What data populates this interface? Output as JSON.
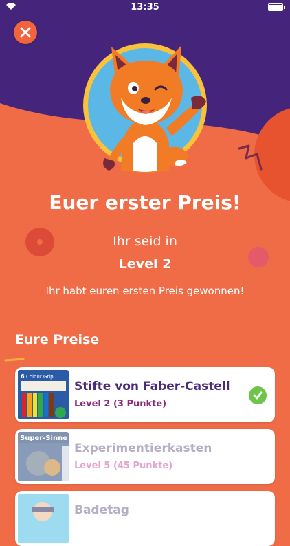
{
  "status_bar": {
    "time": "13:35"
  },
  "header": {
    "close_icon": "close-icon",
    "mascot": "fox-mascot"
  },
  "title": "Euer erster Preis!",
  "level_intro": "Ihr seid in",
  "level": "Level 2",
  "message": "Ihr habt euren ersten Preis gewonnen!",
  "prizes_section": {
    "title": "Eure Preise",
    "items": [
      {
        "name": "Stifte von Faber-Castell",
        "level": "Level 2 (3 Punkte)",
        "unlocked": true,
        "thumb_text": "Colour Grip"
      },
      {
        "name": "Experimentierkasten",
        "level": "Level 5 (45 Punkte)",
        "unlocked": false,
        "thumb_text": "Super-Sinne"
      },
      {
        "name": "Badetag",
        "level": "",
        "unlocked": false,
        "thumb_text": ""
      }
    ]
  },
  "colors": {
    "background": "#f06c47",
    "header_purple": "#45257b",
    "accent_green": "#6fc44a",
    "prize_name": "#4a2a7a"
  }
}
